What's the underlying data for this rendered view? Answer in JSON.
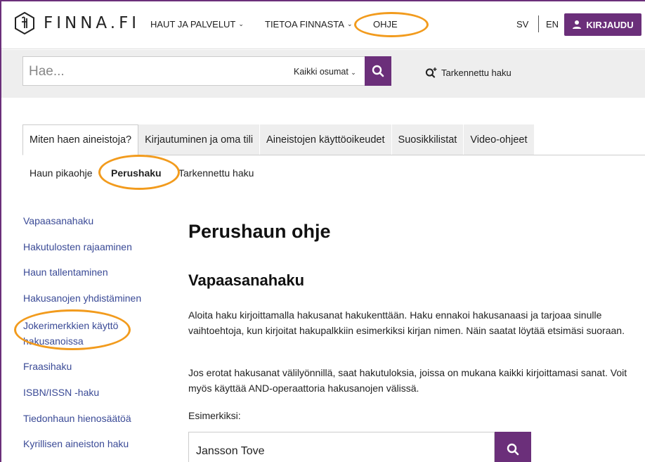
{
  "header": {
    "logo_text": "FINNA.FI",
    "nav": [
      {
        "label": "HAUT JA PALVELUT"
      },
      {
        "label": "TIETOA FINNASTA"
      },
      {
        "label": "OHJE"
      }
    ],
    "lang_sv": "SV",
    "lang_en": "EN",
    "login_label": "KIRJAUDU"
  },
  "search": {
    "placeholder": "Hae...",
    "scope": "Kaikki osumat",
    "advanced_label": "Tarkennettu haku"
  },
  "tabs": [
    {
      "label": "Miten haen aineistoja?",
      "active": true
    },
    {
      "label": "Kirjautuminen ja oma tili"
    },
    {
      "label": "Aineistojen käyttöoikeudet"
    },
    {
      "label": "Suosikkilistat"
    },
    {
      "label": "Video-ohjeet"
    }
  ],
  "subtabs": [
    {
      "label": "Haun pikaohje"
    },
    {
      "label": "Perushaku",
      "active": true
    },
    {
      "label": "Tarkennettu haku"
    }
  ],
  "sidebar": {
    "items": [
      {
        "label": "Vapaasanahaku"
      },
      {
        "label": "Hakutulosten rajaaminen"
      },
      {
        "label": "Haun tallentaminen"
      },
      {
        "label": "Hakusanojen yhdistäminen"
      },
      {
        "label": "Jokerimerkkien käyttö hakusanoissa"
      },
      {
        "label": "Fraasihaku"
      },
      {
        "label": "ISBN/ISSN -haku"
      },
      {
        "label": "Tiedonhaun hienosäätöä"
      },
      {
        "label": "Kyrillisen aineiston haku"
      }
    ]
  },
  "main": {
    "title": "Perushaun ohje",
    "section_title": "Vapaasanahaku",
    "paragraph1": "Aloita haku kirjoittamalla hakusanat hakukenttään. Haku ennakoi hakusanaasi ja tarjoaa sinulle vaihtoehtoja, kun kirjoitat hakupalkkiin esimerkiksi kirjan nimen. Näin saatat löytää etsimäsi suoraan.",
    "paragraph2": "Jos erotat hakusanat välilyönnillä, saat hakutuloksia, joissa on mukana kaikki kirjoittamasi sanat. Voit myös käyttää AND-operaattoria hakusanojen välissä.",
    "example_label": "Esimerkiksi:",
    "example_query": "Jansson Tove"
  },
  "colors": {
    "brand": "#6b2f7a",
    "link": "#3a4a96",
    "highlight": "#f29b1d"
  },
  "icons": [
    "finna-logo-icon",
    "chevron-down-icon",
    "user-icon",
    "search-icon",
    "advanced-search-icon"
  ]
}
